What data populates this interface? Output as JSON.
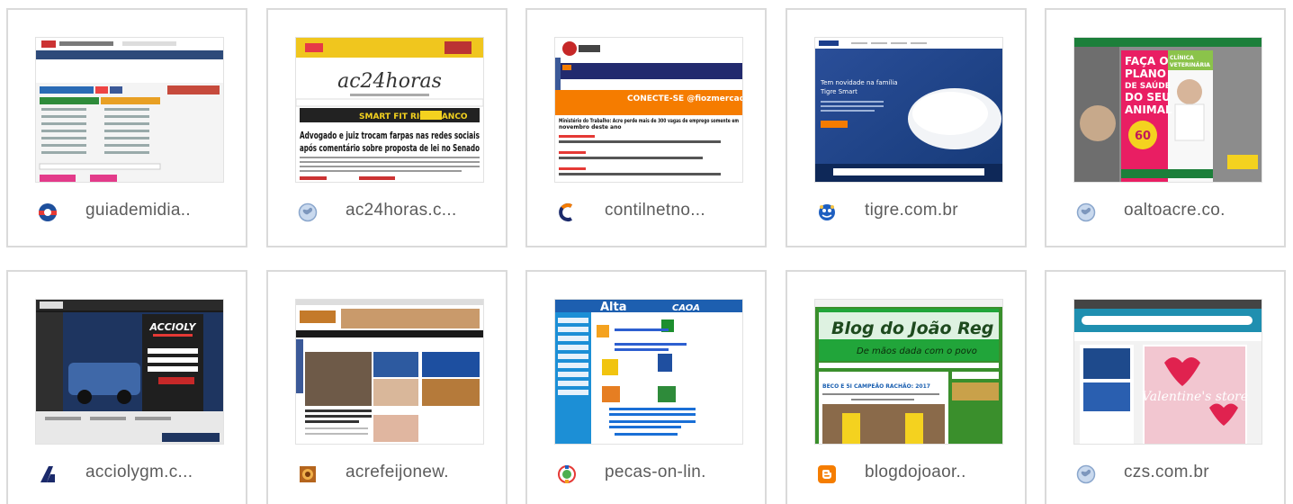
{
  "tiles": [
    {
      "label": "guiademidia..",
      "favicon": "guiademidia-favicon",
      "thumb": "guiademidia-thumbnail"
    },
    {
      "label": "ac24horas.c...",
      "favicon": "globe-icon",
      "thumb": "ac24horas-thumbnail",
      "thumb_logo": "ac24horas",
      "thumb_headline": "Advogado e juiz trocam farpas nas redes sociais após comentário sobre proposta de lei no Senado",
      "thumb_ad": "SMART FIT RIO BRANCO"
    },
    {
      "label": "contilnetno...",
      "favicon": "contilnet-favicon",
      "thumb": "contilnet-thumbnail",
      "thumb_banner": "CONECTE-SE @fiozmercado",
      "thumb_headline": "Ministério do Trabalho: Acre perde mais de 300 vagas de emprego somente em novembro deste ano"
    },
    {
      "label": "tigre.com.br",
      "favicon": "tigre-favicon",
      "thumb": "tigre-thumbnail",
      "thumb_headline": "Tem novidade na família Tigre Smart"
    },
    {
      "label": "oaltoacre.co.",
      "favicon": "globe-icon",
      "thumb": "oaltoacre-thumbnail",
      "thumb_ad": "FAÇA O PLANO DE SAÚDE DO SEU ANIMAL",
      "thumb_ad2": "CLÍNICA VETERINÁRIA",
      "thumb_price": "60"
    },
    {
      "label": "acciolygm.c...",
      "favicon": "acciolygm-favicon",
      "thumb": "acciolygm-thumbnail",
      "thumb_logo": "ACCIOLY"
    },
    {
      "label": "acrefeijonew.",
      "favicon": "acrefeijonews-favicon",
      "thumb": "acrefeijonews-thumbnail"
    },
    {
      "label": "pecas-on-lin.",
      "favicon": "pecas-favicon",
      "thumb": "pecas-on-line-thumbnail",
      "thumb_logo": "Alta",
      "thumb_logo2": "CAOA"
    },
    {
      "label": "blogdojoaor..",
      "favicon": "blogger-icon",
      "thumb": "blogdojoao-thumbnail",
      "thumb_title": "Blog do João Reg",
      "thumb_subtitle": "De mãos dada com o povo",
      "thumb_post": "BECO E 5I CAMPEÃO RACHÃO: 2017"
    },
    {
      "label": "czs.com.br",
      "favicon": "globe-icon",
      "thumb": "czs-thumbnail",
      "thumb_ad": "Valentine's store"
    }
  ]
}
